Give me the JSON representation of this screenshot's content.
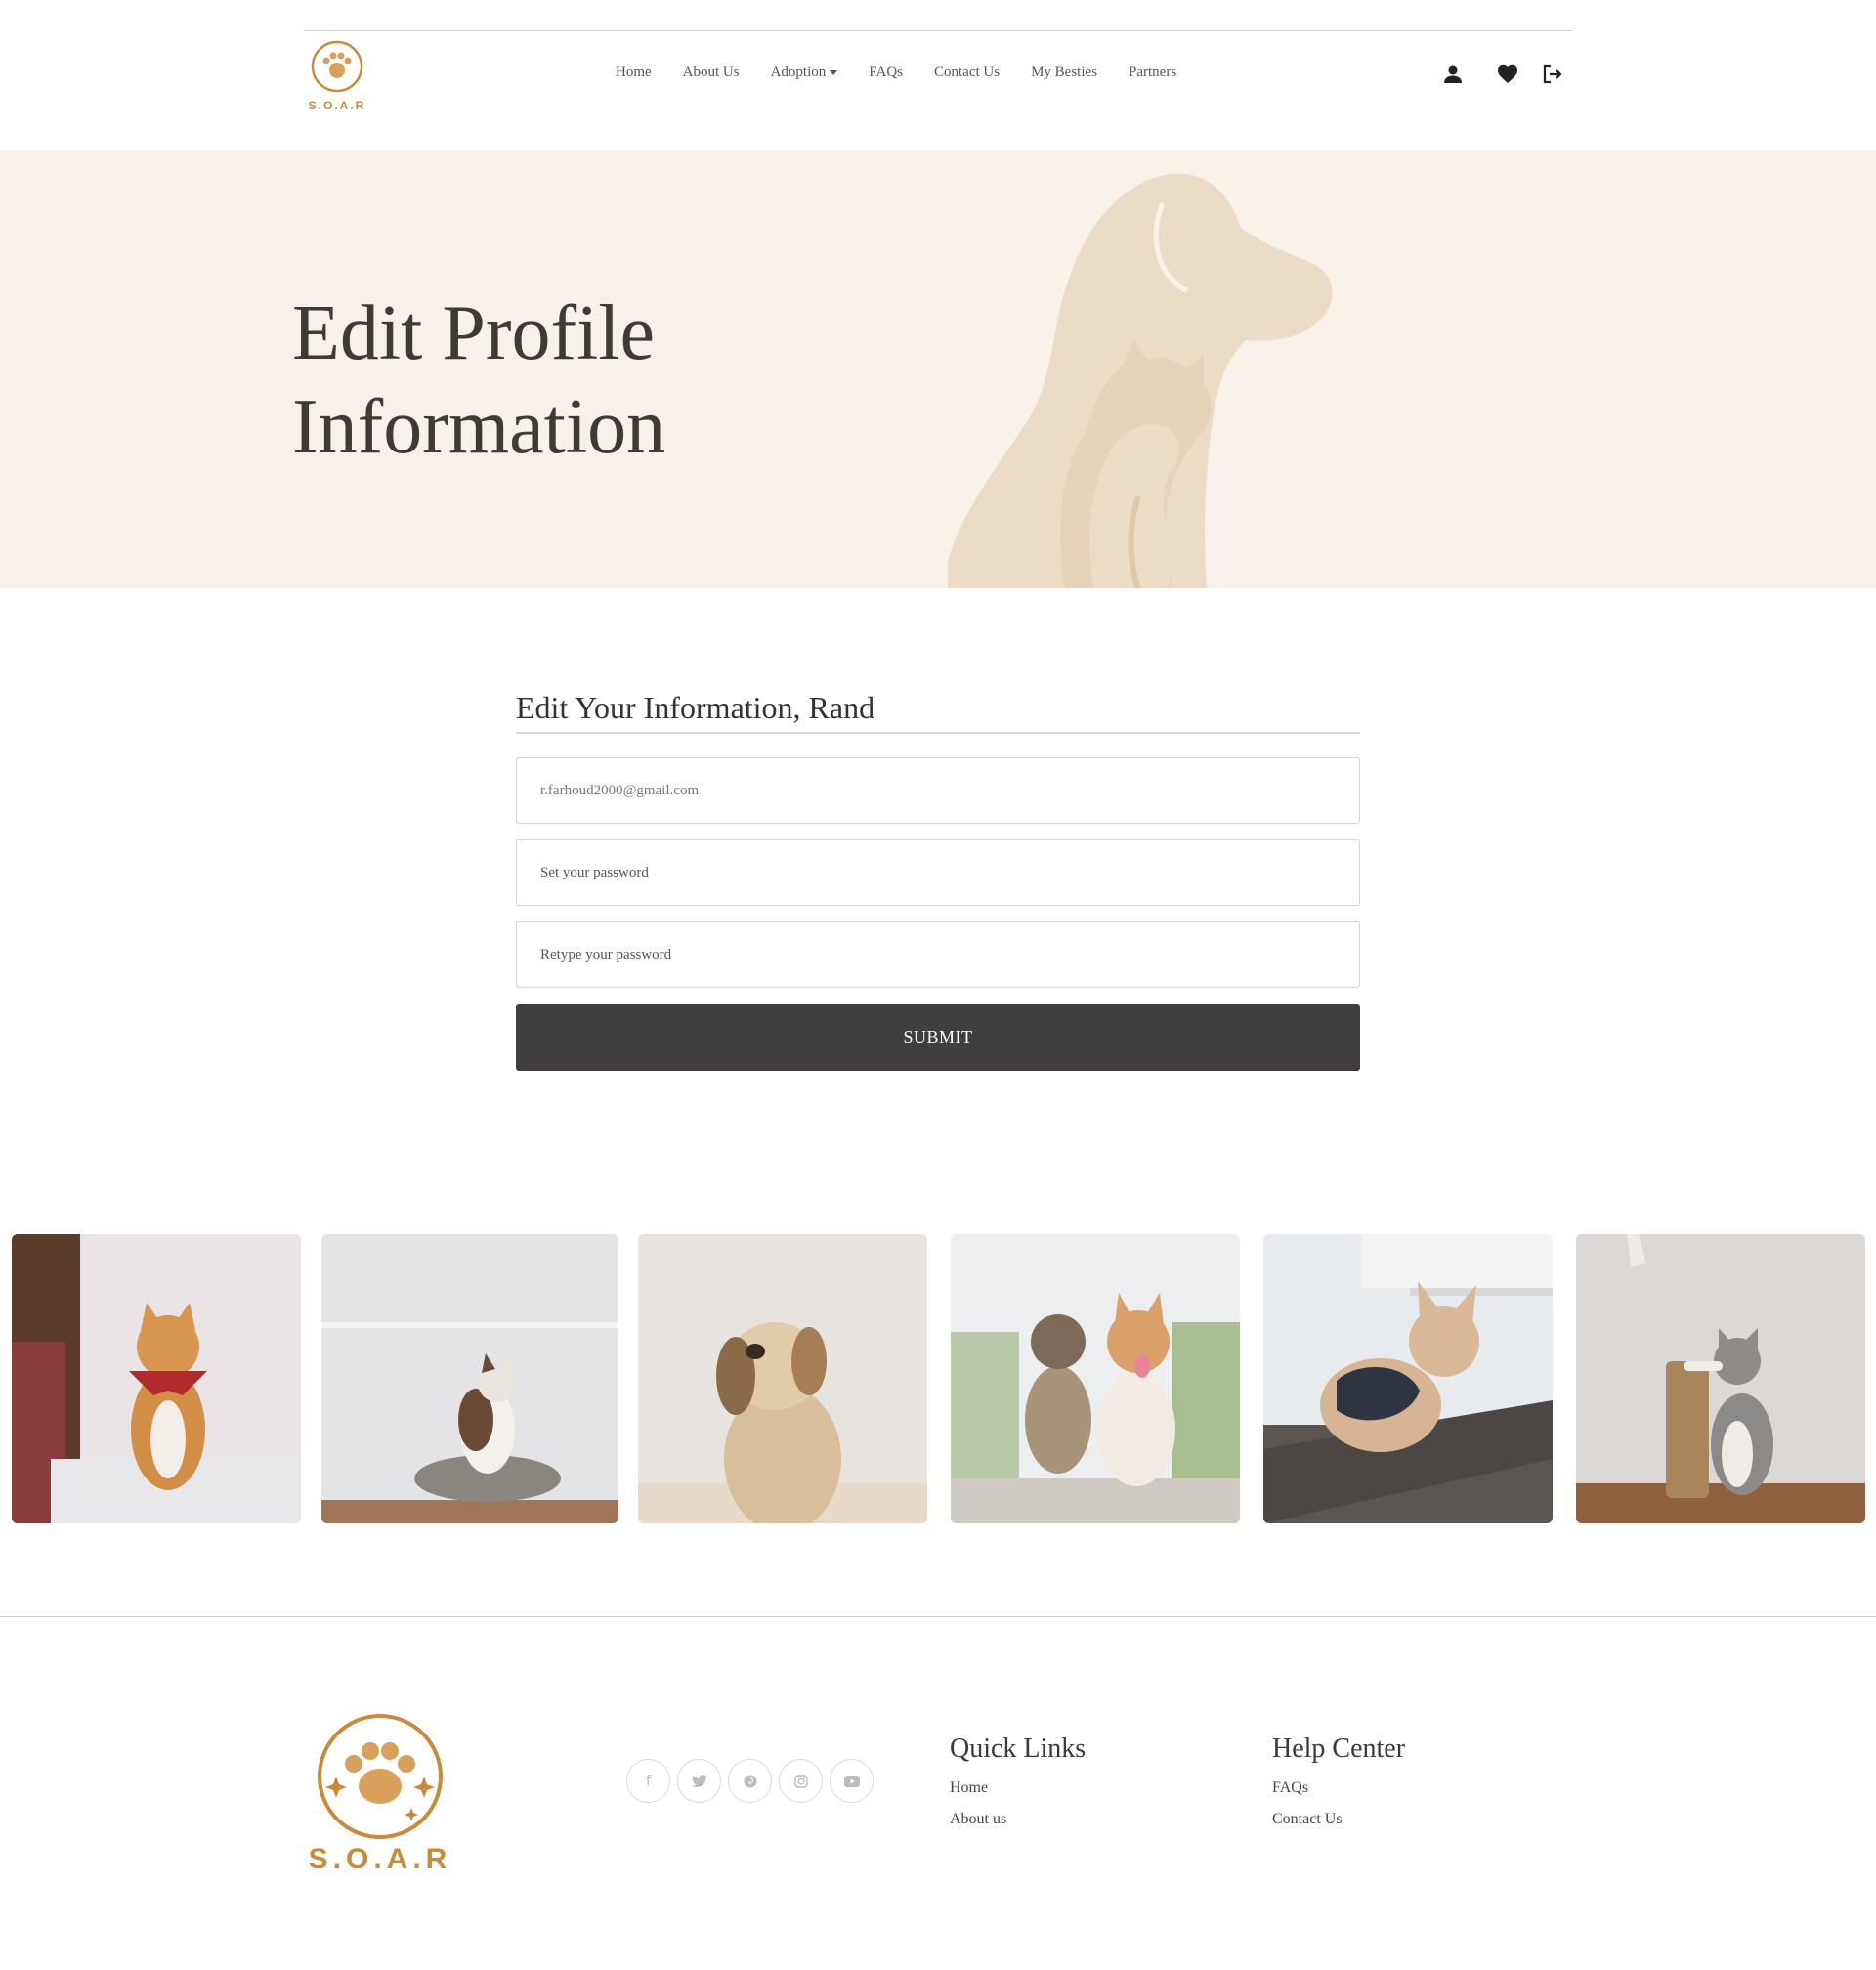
{
  "brand": {
    "name": "S.O.A.R"
  },
  "nav": {
    "items": [
      "Home",
      "About Us",
      "Adoption",
      "FAQs",
      "Contact Us",
      "My Besties",
      "Partners"
    ]
  },
  "header_icons": [
    "user-icon",
    "heart-icon",
    "logout-icon"
  ],
  "hero": {
    "title_line1": "Edit Profile",
    "title_line2": "Information"
  },
  "form": {
    "title": "Edit Your Information, Rand",
    "email_value": "r.farhoud2000@gmail.com",
    "password_placeholder": "Set your password",
    "retype_placeholder": "Retype your password",
    "submit_label": "SUBMIT"
  },
  "gallery": [
    "cat-photo",
    "cat-photo",
    "dog-photo",
    "dogs-photo",
    "dog-photo",
    "kitten-photo"
  ],
  "social": [
    "facebook-icon",
    "twitter-icon",
    "pinterest-icon",
    "instagram-icon",
    "youtube-icon"
  ],
  "footer": {
    "quick_links": {
      "title": "Quick Links",
      "links": [
        "Home",
        "About us"
      ]
    },
    "help_center": {
      "title": "Help Center",
      "links": [
        "FAQs",
        "Contact Us"
      ]
    }
  },
  "colors": {
    "hero_bg": "#f8f1ea",
    "silhouette": "#ecdcc6",
    "button": "#403f3e",
    "brand_gold": "#c98a3a"
  }
}
